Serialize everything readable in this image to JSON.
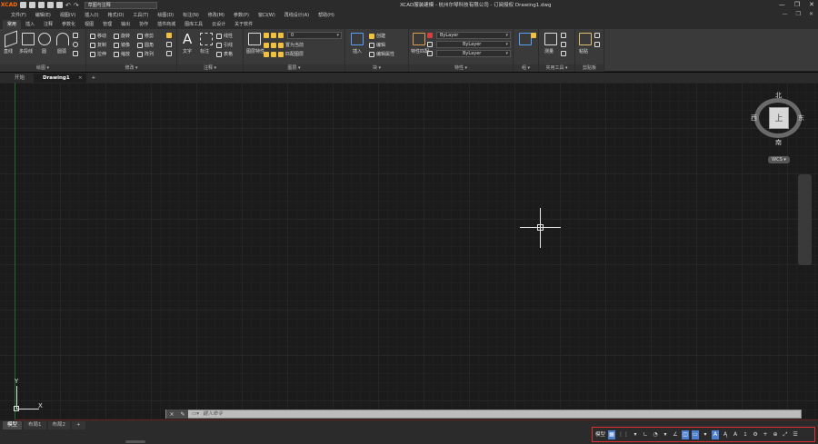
{
  "app": {
    "logo": "XCAD",
    "title": "XCAD服装建模 - 杭州尔琴科技有限公司 - 订阅授权   Drawing1.dwg",
    "workspace": "草图与注释"
  },
  "menu": [
    "文件(F)",
    "编辑(E)",
    "视图(V)",
    "插入(I)",
    "格式(O)",
    "工具(T)",
    "绘图(D)",
    "标注(N)",
    "修改(M)",
    "参数(P)",
    "窗口(W)",
    "再线设计(A)",
    "帮助(H)"
  ],
  "ribbon_tabs": [
    "常用",
    "插入",
    "注释",
    "参数化",
    "视图",
    "管理",
    "输出",
    "协作",
    "插件商城",
    "图库工具",
    "云设计",
    "关于软件"
  ],
  "ribbon_active_tab": "常用",
  "panels": {
    "draw": {
      "title": "绘图 ▾",
      "line": "直线",
      "polyline": "多段线",
      "circle": "圆",
      "arc": "圆弧"
    },
    "modify": {
      "title": "修改 ▾",
      "move": "移动",
      "rotate": "旋转",
      "trim": "修剪",
      "copy": "复制",
      "mirror": "镜像",
      "fillet": "圆角",
      "stretch": "拉伸",
      "scale": "缩放",
      "array": "阵列"
    },
    "annotation": {
      "title": "注释 ▾",
      "text": "文字",
      "dimension": "标注",
      "linear": "线性",
      "leader": "引线",
      "table": "表格"
    },
    "layers": {
      "title": "图层 ▾",
      "layer_props": "图层特性",
      "current_layer": "0",
      "make_current": "置为当前",
      "match_layer": "匹配图层"
    },
    "block": {
      "title": "块 ▾",
      "insert": "插入",
      "create": "创建",
      "edit": "编辑",
      "edit_attr": "编辑属性"
    },
    "properties": {
      "title": "特性 ▾",
      "match": "特性匹配",
      "color": "ByLayer",
      "linetype": "ByLayer",
      "lineweight": "ByLayer"
    },
    "groups": {
      "title": "组 ▾",
      "group": "组"
    },
    "utilities": {
      "title": "实用工具 ▾",
      "measure": "测量"
    },
    "clipboard": {
      "title": "剪贴板",
      "paste": "粘贴"
    }
  },
  "doc_tabs": {
    "start": "开始",
    "drawing": "Drawing1",
    "close": "×",
    "add": "+"
  },
  "viewcube": {
    "north": "北",
    "south": "南",
    "east": "东",
    "west": "西",
    "face": "上",
    "wcs": "WCS ▾"
  },
  "ucs": {
    "x": "X",
    "y": "Y"
  },
  "command": {
    "placeholder": "键入命令",
    "close": "×",
    "wrench": "✎"
  },
  "layout_tabs": [
    "模型",
    "布局1",
    "布局2",
    "+"
  ],
  "status_bar": {
    "model": "模型",
    "scale": "1:1",
    "annoscale": "1"
  },
  "colors": {
    "accent": "#4d7fd0",
    "status_border": "#e53030",
    "ucs": "#e0e0e0"
  }
}
